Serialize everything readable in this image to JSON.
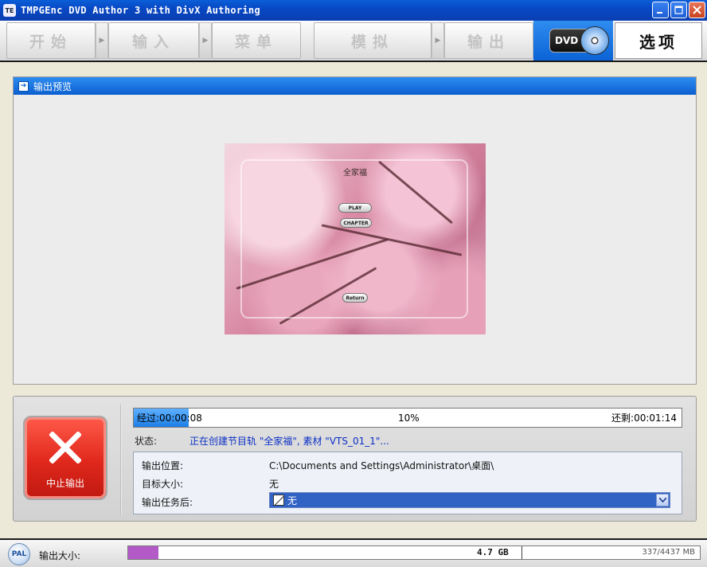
{
  "window": {
    "title": "TMPGEnc DVD Author 3 with DivX Authoring",
    "icon_text": "TE",
    "controls": [
      "minimize",
      "maximize",
      "close"
    ]
  },
  "nav": {
    "steps": [
      "开始",
      "输入",
      "菜单",
      "模拟",
      "输出"
    ],
    "dvd_label": "DVD",
    "options_label": "选项"
  },
  "preview": {
    "header": "输出预览",
    "menu_title": "全家福",
    "buttons": {
      "play": "PLAY",
      "chapter": "CHAPTER",
      "return": "Return"
    }
  },
  "progress": {
    "elapsed": "经过:00:00:08",
    "percent_text": "10%",
    "percent": 10,
    "remaining": "还剩:00:01:14",
    "status_label": "状态:",
    "status_value": "正在创建节目轨 \"全家福\", 素材 \"VTS_01_1\"..."
  },
  "stop_button": {
    "label": "中止输出"
  },
  "info": {
    "output_location_label": "输出位置:",
    "output_location_value": "C:\\Documents and Settings\\Administrator\\桌面\\",
    "target_size_label": "目标大小:",
    "target_size_value": "无",
    "after_task_label": "输出任务后:",
    "after_task_value": "无"
  },
  "status_bar": {
    "video_standard": "PAL",
    "size_label": "输出大小:",
    "disc_capacity_label": "4.7 GB",
    "usage_text": "337/4437 MB",
    "usage_used_mb": 337,
    "usage_total_mb": 4437
  },
  "colors": {
    "titlebar": "#0848c4",
    "accent_blue": "#1d7fe6",
    "stop_red": "#e0281c",
    "size_fill": "#b45ac8"
  }
}
